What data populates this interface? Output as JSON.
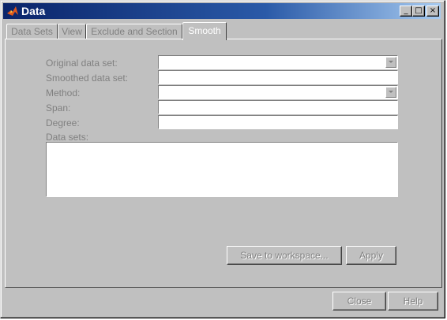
{
  "window": {
    "title": "Data",
    "controls": {
      "minimize": "_",
      "maximize": "□",
      "close": "×"
    },
    "icon": "matlab-logo-icon"
  },
  "tabs": [
    {
      "label": "Data Sets",
      "active": false
    },
    {
      "label": "View",
      "active": false
    },
    {
      "label": "Exclude and Section",
      "active": false
    },
    {
      "label": "Smooth",
      "active": true
    }
  ],
  "smooth": {
    "original_label": "Original data set:",
    "smoothed_label": "Smoothed data set:",
    "method_label": "Method:",
    "span_label": "Span:",
    "degree_label": "Degree:",
    "datasets_label": "Data sets:",
    "save_button": "Save to workspace...",
    "apply_button": "Apply"
  },
  "footer": {
    "close_button": "Close",
    "help_button": "Help"
  },
  "colors": {
    "face": "#c0c0c0",
    "title_gradient_start": "#0a246a",
    "disabled_text": "#808080"
  }
}
